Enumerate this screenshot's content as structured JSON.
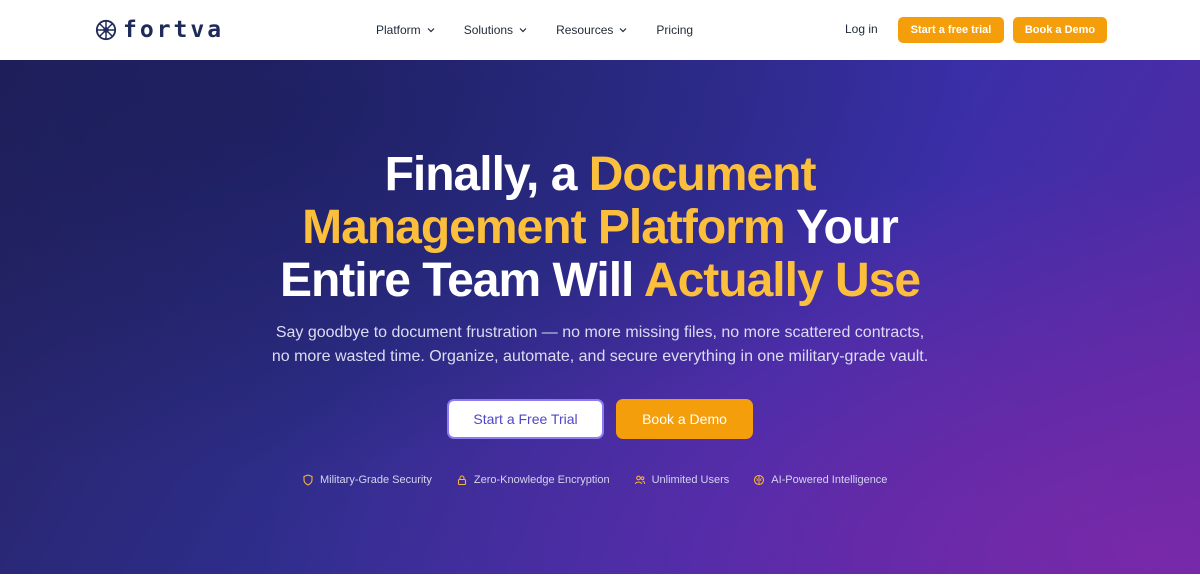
{
  "header": {
    "logo_text": "fortva",
    "nav": [
      {
        "label": "Platform"
      },
      {
        "label": "Solutions"
      },
      {
        "label": "Resources"
      },
      {
        "label": "Pricing"
      }
    ],
    "login_label": "Log in",
    "trial_label": "Start a free trial",
    "demo_label": "Book a Demo"
  },
  "hero": {
    "headline": {
      "part1": "Finally, a ",
      "part2_accent": "Document",
      "part3_accent": "Management Platform",
      "part4": " Your",
      "part5": "Entire Team Will ",
      "part6_accent": "Actually Use"
    },
    "subtitle_line1": "Say goodbye to document frustration — no more missing files, no more scattered contracts,",
    "subtitle_line2": "no more wasted time. Organize, automate, and secure everything in one military-grade vault.",
    "cta_trial": "Start a Free Trial",
    "cta_demo": "Book a Demo",
    "features": [
      {
        "icon": "shield-icon",
        "label": "Military-Grade Security"
      },
      {
        "icon": "lock-icon",
        "label": "Zero-Knowledge Encryption"
      },
      {
        "icon": "users-icon",
        "label": "Unlimited Users"
      },
      {
        "icon": "brain-icon",
        "label": "AI-Powered Intelligence"
      }
    ]
  },
  "colors": {
    "accent": "#f59e0b",
    "headline_accent": "#fbbf3c",
    "hero_bg_start": "#24225f",
    "hero_bg_end": "#5a2aa5",
    "logo": "#1e2a5a"
  }
}
